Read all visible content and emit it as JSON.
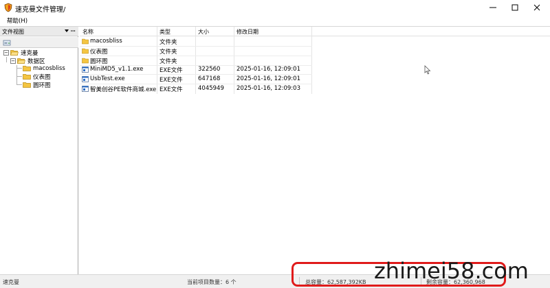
{
  "window": {
    "title": "速克曼文件管理/"
  },
  "menu": {
    "help": "帮助(H)"
  },
  "tree": {
    "title": "文件视图",
    "pin": "ꟷ",
    "nodes": [
      {
        "label": "速克曼",
        "expander": "−"
      },
      {
        "label": "数据区",
        "expander": "−"
      },
      {
        "label": "macosbliss"
      },
      {
        "label": "仪表图"
      },
      {
        "label": "圆环图"
      }
    ]
  },
  "list": {
    "columns": [
      "名称",
      "类型",
      "大小",
      "修改日期"
    ],
    "rows": [
      {
        "name": "macosbliss",
        "type": "文件夹",
        "size": "",
        "date": "",
        "icon": "folder-icon"
      },
      {
        "name": "仪表图",
        "type": "文件夹",
        "size": "",
        "date": "",
        "icon": "folder-icon"
      },
      {
        "name": "圆环图",
        "type": "文件夹",
        "size": "",
        "date": "",
        "icon": "folder-icon"
      },
      {
        "name": "MiniMD5_v1.1.exe",
        "type": "EXE文件",
        "size": "322560",
        "date": "2025-01-16, 12:09:01",
        "icon": "exe-icon"
      },
      {
        "name": "UsbTest.exe",
        "type": "EXE文件",
        "size": "647168",
        "date": "2025-01-16, 12:09:01",
        "icon": "exe-icon"
      },
      {
        "name": "智美创谷PE软件商城.exe",
        "type": "EXE文件",
        "size": "4045949",
        "date": "2025-01-16, 12:09:03",
        "icon": "exe-icon"
      }
    ]
  },
  "status": {
    "location": "速克曼",
    "count": "当前项目数量：6 个",
    "capacity": "总容量：62,587,392KB",
    "free": "剩余容量：62,360,968"
  },
  "watermark": {
    "text": "zhimei58.com",
    "color": "#e01a1a"
  },
  "colors": {
    "folder": "#f4c542",
    "accent": "#2b6cc4"
  }
}
